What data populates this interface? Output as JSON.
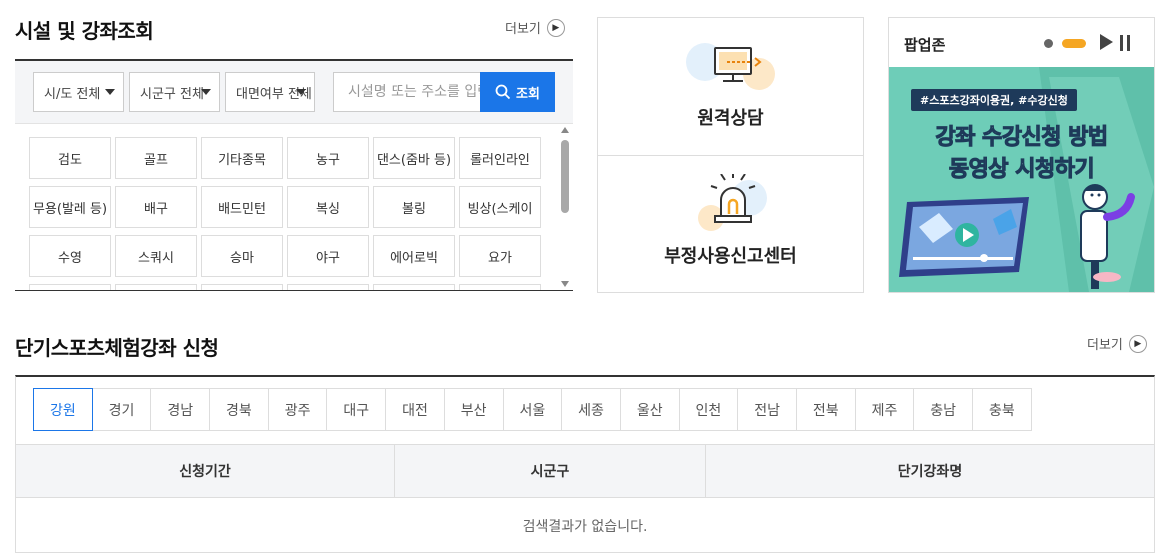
{
  "facility": {
    "title": "시설 및 강좌조회",
    "more_label": "더보기",
    "filters": {
      "sido": "시/도 전체",
      "sigungu": "시군구 전체",
      "inperson": "대면여부 전체"
    },
    "search_placeholder": "시설명 또는 주소를 입력",
    "search_button": "조회",
    "sports": [
      "검도",
      "골프",
      "기타종목",
      "농구",
      "댄스(줌바 등)",
      "롤러인라인",
      "무용(발레 등)",
      "배구",
      "배드민턴",
      "복싱",
      "볼링",
      "빙상(스케이",
      "수영",
      "스쿼시",
      "승마",
      "야구",
      "에어로빅",
      "요가",
      "",
      "",
      "",
      "",
      "",
      ""
    ]
  },
  "services": {
    "remote_consult": "원격상담",
    "fraud_report": "부정사용신고센터"
  },
  "popup": {
    "title": "팝업존",
    "banner_tag": "#스포츠강좌이용권, #수강신청",
    "banner_line1": "강좌 수강신청 방법",
    "banner_line2": "동영상 시청하기"
  },
  "lecture": {
    "title": "단기스포츠체험강좌 신청",
    "more_label": "더보기",
    "regions": [
      "강원",
      "경기",
      "경남",
      "경북",
      "광주",
      "대구",
      "대전",
      "부산",
      "서울",
      "세종",
      "울산",
      "인천",
      "전남",
      "전북",
      "제주",
      "충남",
      "충북"
    ],
    "active_region": "강원",
    "columns": [
      "신청기간",
      "시군구",
      "단기강좌명"
    ],
    "empty_message": "검색결과가 없습니다."
  },
  "colors": {
    "accent_blue": "#1b76e8",
    "indicator_orange": "#f5a623",
    "banner_green": "#6ecdb8"
  }
}
